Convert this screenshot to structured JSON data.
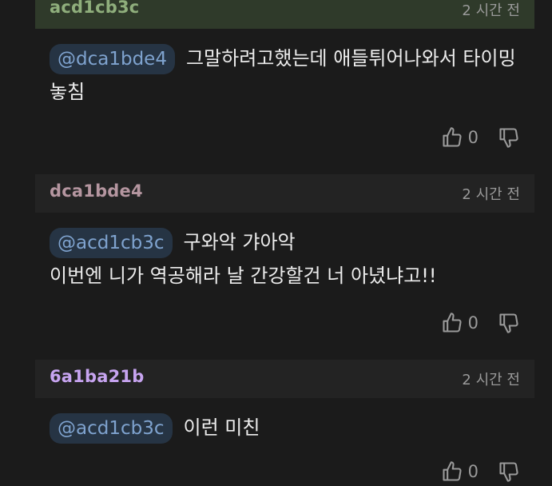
{
  "comments": [
    {
      "author": "acd1cb3c",
      "author_color": "#8fae7c",
      "time": "2 시간 전",
      "mention": "@dca1bde4",
      "text": "그말하려고했는데 애들튀어나와서 타이밍 놓침",
      "likes": "0"
    },
    {
      "author": "dca1bde4",
      "author_color": "#b596a0",
      "time": "2 시간 전",
      "mention": "@acd1cb3c",
      "text": "구와악 갸아악\n이번엔 니가 역공해라 날 간강할건 너 아녔냐고!!",
      "likes": "0"
    },
    {
      "author": "6a1ba21b",
      "author_color": "#c7a4f0",
      "time": "2 시간 전",
      "mention": "@acd1cb3c",
      "text": "이런 미친",
      "likes": "0"
    }
  ],
  "icons": {
    "like": "thumbs-up-icon",
    "dislike": "thumbs-down-icon"
  },
  "colors": {
    "background": "#1b1b1b",
    "mention_bg": "#263444",
    "mention_text": "#7fa3cf"
  }
}
